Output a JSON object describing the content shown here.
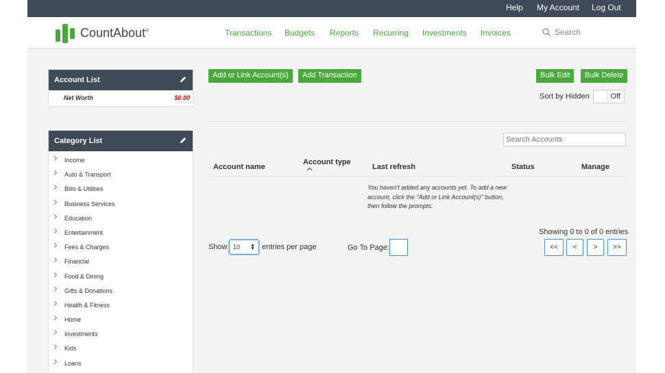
{
  "topbar": {
    "help": "Help",
    "my_account": "My Account",
    "logout": "Log Out"
  },
  "brand": {
    "name": "CountAbout",
    "mark": "®"
  },
  "nav": [
    "Transactions",
    "Budgets",
    "Reports",
    "Recurring",
    "Investments",
    "Invoices"
  ],
  "search": {
    "label": "Search"
  },
  "account_list": {
    "title": "Account List",
    "net_worth_label": "Net Worth",
    "net_worth_value": "$0.00"
  },
  "category_list": {
    "title": "Category List",
    "items": [
      "Income",
      "Auto & Transport",
      "Bills & Utilities",
      "Business Services",
      "Education",
      "Entertainment",
      "Fees & Charges",
      "Financial",
      "Food & Dining",
      "Gifts & Donations",
      "Health & Fitness",
      "Home",
      "Investments",
      "Kids",
      "Loans"
    ]
  },
  "actions": {
    "add_link": "Add or Link Account(s)",
    "add_transaction": "Add Transaction",
    "bulk_edit": "Bulk Edit",
    "bulk_delete": "Bulk Delete"
  },
  "sort_hidden": {
    "label": "Sort by Hidden",
    "state": "Off"
  },
  "table": {
    "search_placeholder": "Search Accounts",
    "columns": {
      "name": "Account name",
      "type": "Account type",
      "refresh": "Last refresh",
      "status": "Status",
      "manage": "Manage"
    },
    "empty_message": "You haven't added any accounts yet. To add a new account, click the \"Add or Link Account(s)\" button, then follow the prompts."
  },
  "pagination": {
    "show": "Show",
    "per_page_value": "10",
    "per_page_suffix": "entries per page",
    "go_to": "Go To Page:",
    "summary": "Showing 0 to 0 of 0 entries",
    "first": "<<",
    "prev": "<",
    "next": ">",
    "last": ">>"
  },
  "colors": {
    "accent": "#4aa83c",
    "dark": "#3e4a56",
    "negative": "#cc0000"
  }
}
